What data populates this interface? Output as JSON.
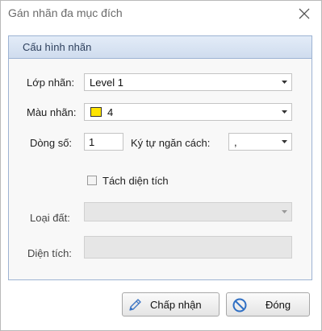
{
  "window": {
    "title": "Gán nhãn đa mục đích"
  },
  "group": {
    "title": "Cấu hình nhãn"
  },
  "fields": {
    "layer": {
      "label": "Lớp nhãn:",
      "value": "Level 1"
    },
    "color": {
      "label": "Màu nhãn:",
      "value": "4",
      "swatch_color": "#ffe400"
    },
    "line_no": {
      "label": "Dòng số:",
      "value": "1"
    },
    "separator": {
      "label": "Ký tự ngăn cách:",
      "value": ","
    },
    "split_area": {
      "label": "Tách diện tích",
      "checked": false
    },
    "land_type": {
      "label": "Loại đất:",
      "value": ""
    },
    "area": {
      "label": "Diện tích:",
      "value": ""
    }
  },
  "buttons": {
    "accept": {
      "label": "Chấp nhận",
      "icon": "pencil-icon"
    },
    "close": {
      "label": "Đóng",
      "icon": "no-entry-icon"
    }
  },
  "colors": {
    "accent_border": "#9db3d3",
    "header_text": "#2d3f5c"
  }
}
